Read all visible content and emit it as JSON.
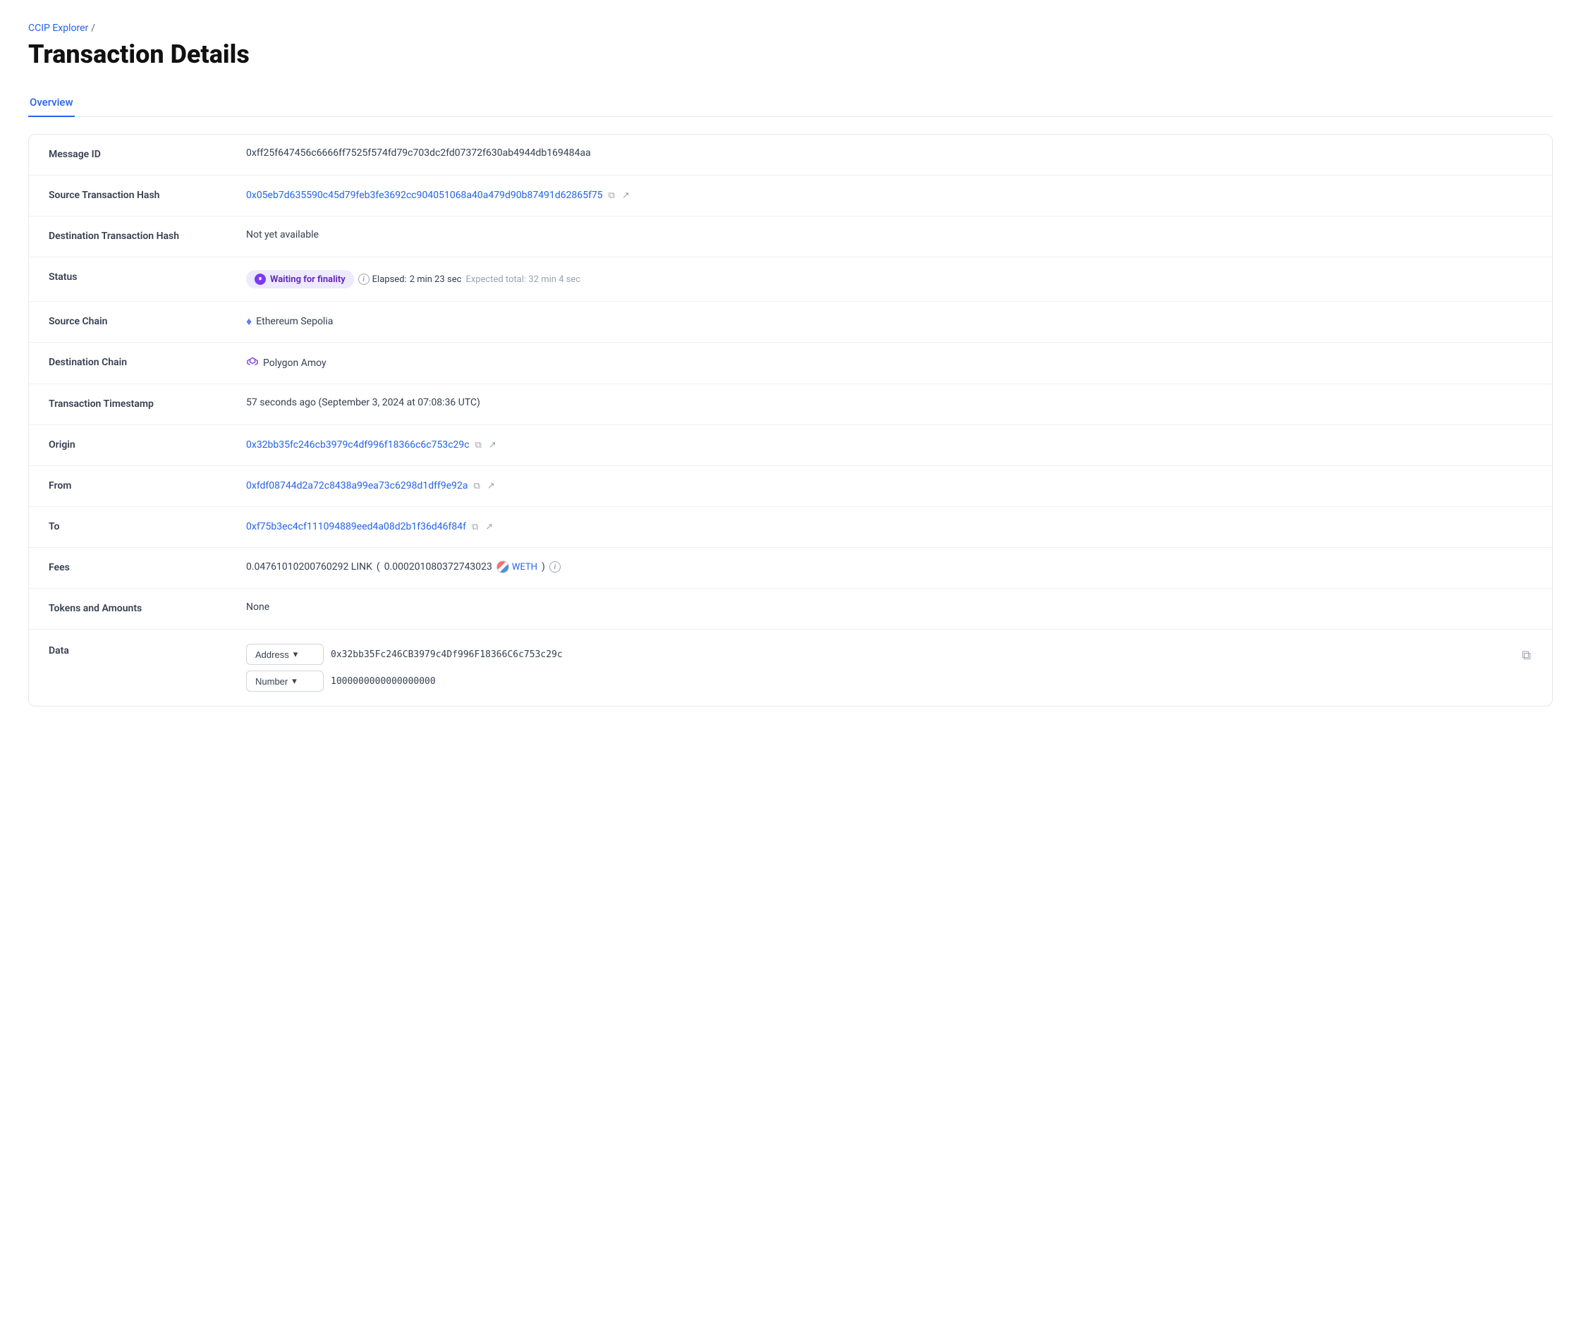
{
  "breadcrumb": {
    "link_label": "CCIP Explorer",
    "separator": "/",
    "current": ""
  },
  "page": {
    "title": "Transaction Details"
  },
  "tabs": [
    {
      "id": "overview",
      "label": "Overview",
      "active": true
    }
  ],
  "details": {
    "message_id": {
      "label": "Message ID",
      "value": "0xff25f647456c6666ff7525f574fd79c703dc2fd07372f630ab4944db169484aa"
    },
    "source_tx_hash": {
      "label": "Source Transaction Hash",
      "value": "0x05eb7d635590c45d79feb3fe3692cc904051068a40a479d90b87491d62865f75"
    },
    "dest_tx_hash": {
      "label": "Destination Transaction Hash",
      "value": "Not yet available"
    },
    "status": {
      "label": "Status",
      "badge": "Waiting for finality",
      "elapsed_label": "Elapsed:",
      "elapsed_value": "2 min 23 sec",
      "expected_label": "Expected total:",
      "expected_value": "32 min 4 sec"
    },
    "source_chain": {
      "label": "Source Chain",
      "value": "Ethereum Sepolia"
    },
    "destination_chain": {
      "label": "Destination Chain",
      "value": "Polygon Amoy"
    },
    "transaction_timestamp": {
      "label": "Transaction Timestamp",
      "value": "57 seconds ago (September 3, 2024 at 07:08:36 UTC)"
    },
    "origin": {
      "label": "Origin",
      "value": "0x32bb35fc246cb3979c4df996f18366c6c753c29c"
    },
    "from": {
      "label": "From",
      "value": "0xfdf08744d2a72c8438a99ea73c6298d1dff9e92a"
    },
    "to": {
      "label": "To",
      "value": "0xf75b3ec4cf111094889eed4a08d2b1f36d46f84f"
    },
    "fees": {
      "label": "Fees",
      "link_amount": "0.04761010200760292 LINK",
      "paren_open": "(",
      "weth_amount": "0.000201080372743023",
      "weth_label": "WETH",
      "paren_close": ")"
    },
    "tokens_and_amounts": {
      "label": "Tokens and Amounts",
      "value": "None"
    },
    "data": {
      "label": "Data",
      "rows": [
        {
          "type": "Address",
          "value": "0x32bb35Fc246CB3979c4Df996F18366C6c753c29c"
        },
        {
          "type": "Number",
          "value": "1000000000000000000"
        }
      ]
    }
  },
  "icons": {
    "copy": "⧉",
    "external": "↗",
    "info": "i",
    "chevron_down": "▾",
    "pause": "⏸",
    "copy_block": "⧉"
  }
}
